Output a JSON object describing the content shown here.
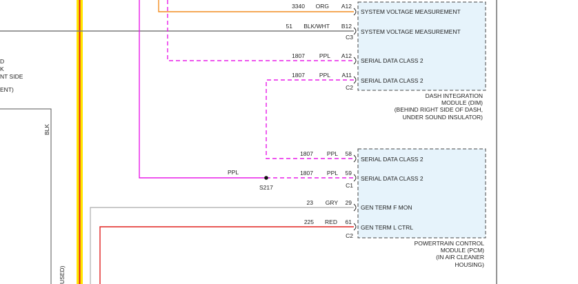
{
  "colors": {
    "orange": "#f28c1e",
    "gray": "#7a7a7a",
    "magenta": "#e81be8",
    "yellow": "#ffe600",
    "red": "#e0201f",
    "light_gray": "#b8b8b8",
    "module_fill": "#e6f3fb",
    "black": "#222222"
  },
  "left_text": {
    "line1": "D",
    "line2": "K",
    "line3": "NT SIDE",
    "line4": "ENT)",
    "vertical_blk": "BLK",
    "vertical_used": "USED)"
  },
  "dim_module": {
    "label_line1": "DASH INTEGRATION",
    "label_line2": "MODULE (DIM)",
    "label_line3": "(BEHIND RIGHT SIDE OF DASH,",
    "label_line4": "UNDER SOUND INSULATOR)",
    "connector_c3": "C3",
    "connector_c2": "C2"
  },
  "pcm_module": {
    "label_line1": "POWERTRAIN CONTROL",
    "label_line2": "MODULE (PCM)",
    "label_line3": "(IN AIR CLEANER",
    "label_line4": "HOUSING)",
    "connector_c1": "C1",
    "connector_c2": "C2"
  },
  "wires": [
    {
      "circuit": "3340",
      "color": "ORG",
      "pin": "A12",
      "signal": "SYSTEM VOLTAGE MEASUREMENT"
    },
    {
      "circuit": "51",
      "color": "BLK/WHT",
      "pin": "B12",
      "signal": "SYSTEM VOLTAGE MEASUREMENT"
    },
    {
      "circuit": "1807",
      "color": "PPL",
      "pin": "A12",
      "signal": "SERIAL DATA CLASS 2"
    },
    {
      "circuit": "1807",
      "color": "PPL",
      "pin": "A11",
      "signal": "SERIAL DATA CLASS 2"
    },
    {
      "circuit": "1807",
      "color": "PPL",
      "pin": "58",
      "signal": "SERIAL DATA CLASS 2"
    },
    {
      "circuit": "1807",
      "color": "PPL",
      "pin": "59",
      "signal": "SERIAL DATA CLASS 2"
    },
    {
      "circuit": "23",
      "color": "GRY",
      "pin": "29",
      "signal": "GEN TERM F MON"
    },
    {
      "circuit": "225",
      "color": "RED",
      "pin": "61",
      "signal": "GEN TERM L CTRL"
    }
  ],
  "splice": {
    "name": "S217",
    "wire_color": "PPL"
  }
}
